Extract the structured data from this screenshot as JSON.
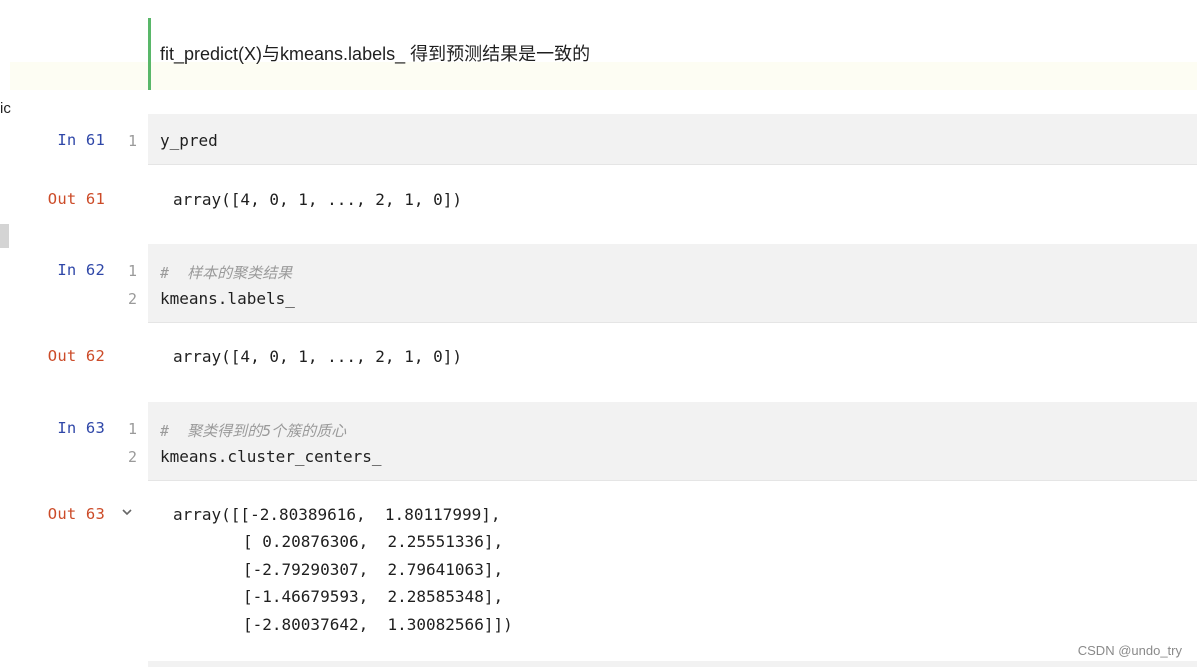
{
  "left_fragment": "ic",
  "markdown": {
    "text": "fit_predict(X)与kmeans.labels_ 得到预测结果是一致的"
  },
  "cells": [
    {
      "in_prompt": "In 61",
      "line_numbers": [
        "1"
      ],
      "code_lines": [
        "y_pred"
      ],
      "out_prompt": "Out 61",
      "output": "array([4, 0, 1, ..., 2, 1, 0])"
    },
    {
      "in_prompt": "In 62",
      "line_numbers": [
        "1",
        "2"
      ],
      "comment": "#  样本的聚类结果",
      "code_lines": [
        "kmeans.labels_"
      ],
      "out_prompt": "Out 62",
      "output": "array([4, 0, 1, ..., 2, 1, 0])"
    },
    {
      "in_prompt": "In 63",
      "line_numbers": [
        "1",
        "2"
      ],
      "comment": "#  聚类得到的5个簇的质心",
      "code_lines": [
        "kmeans.cluster_centers_"
      ],
      "out_prompt": "Out 63",
      "output_lines": [
        "array([[-2.80389616,  1.80117999],",
        "[ 0.20876306,  2.25551336],",
        "[-2.79290307,  2.79641063],",
        "[-1.46679593,  2.28585348],",
        "[-2.80037642,  1.30082566]])"
      ]
    }
  ],
  "watermark": "CSDN @undo_try"
}
